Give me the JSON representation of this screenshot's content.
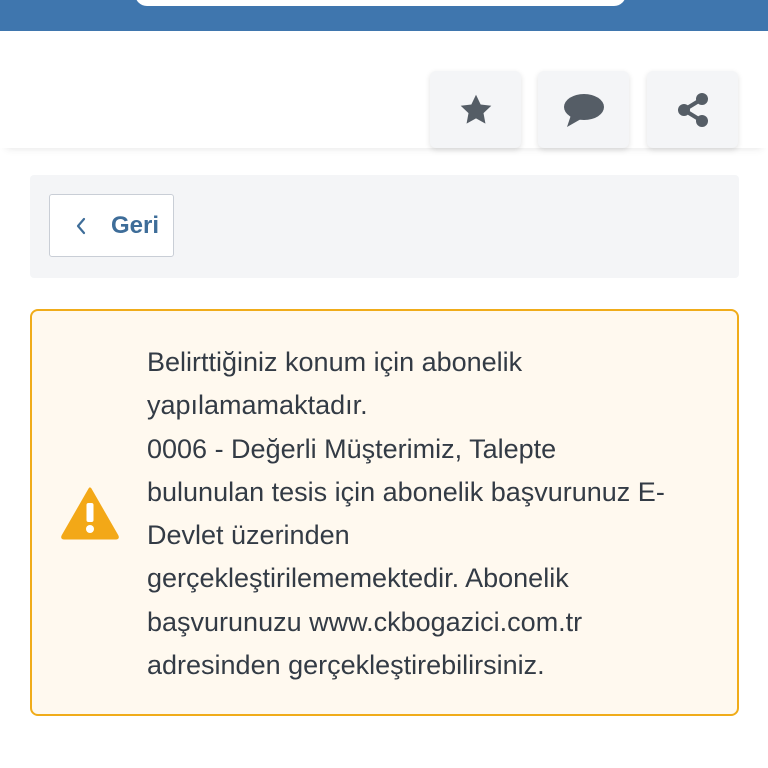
{
  "colors": {
    "header": "#3f76ae",
    "accent_text": "#3e6d99",
    "warning_border": "#f0ac1a",
    "warning_bg": "#fff9ef",
    "warning_icon": "#f3a817",
    "icon_gray": "#555d66"
  },
  "actions": [
    {
      "icon": "star-icon"
    },
    {
      "icon": "comment-icon"
    },
    {
      "icon": "share-icon"
    }
  ],
  "back": {
    "label": "Geri",
    "icon": "chevron-left-icon"
  },
  "alert": {
    "icon": "warning-icon",
    "lines": [
      "Belirttiğiniz konum için abonelik",
      "yapılamamaktadır.",
      "0006 - Değerli Müşterimiz, Talepte",
      "bulunulan tesis için abonelik başvurunuz E-",
      "Devlet üzerinden",
      "gerçekleştirilememektedir. Abonelik",
      "başvurunuzu www.ckbogazici.com.tr",
      "adresinden gerçekleştirebilirsiniz."
    ]
  }
}
